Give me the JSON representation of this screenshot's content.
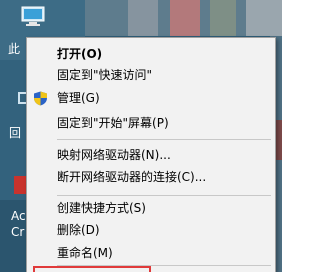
{
  "desktop": {
    "label_1": "此",
    "label_2": "回",
    "label_3": "Ac",
    "label_4": "Cr"
  },
  "context_menu": {
    "items": [
      {
        "label": "打开(O)",
        "bold": true
      },
      {
        "label": "固定到\"快速访问\""
      },
      {
        "label": "管理(G)",
        "icon": "uac-shield-icon"
      },
      {
        "label": "固定到\"开始\"屏幕(P)"
      },
      {
        "label": "映射网络驱动器(N)..."
      },
      {
        "label": "断开网络驱动器的连接(C)..."
      },
      {
        "label": "创建快捷方式(S)"
      },
      {
        "label": "删除(D)"
      },
      {
        "label": "重命名(M)"
      }
    ]
  },
  "colors": {
    "menu_background": "#f2f2f2",
    "highlight_border": "#e03a3a"
  }
}
